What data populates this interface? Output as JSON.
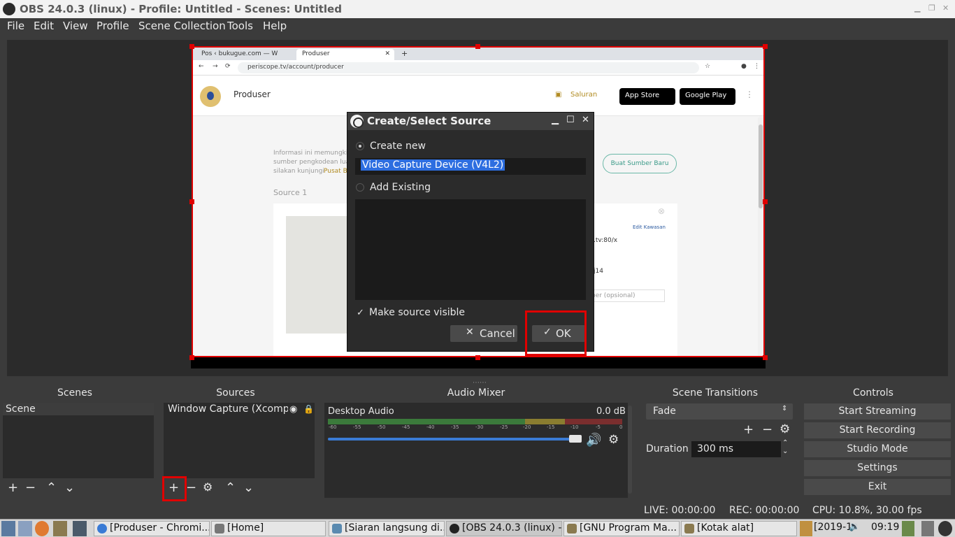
{
  "window": {
    "title": "OBS 24.0.3 (linux) - Profile: Untitled - Scenes: Untitled"
  },
  "menu": [
    "File",
    "Edit",
    "View",
    "Profile",
    "Scene Collection",
    "Tools",
    "Help"
  ],
  "browser": {
    "tab1": "Pos ‹ bukugue.com — W",
    "tab2": "Produser",
    "url": "periscope.tv/account/producer",
    "page_title": "Produser",
    "saluran": "Saluran",
    "appstore": "App Store",
    "googleplay": "Google Play",
    "info1": "Informasi ini memungki",
    "info2": "sumber pengkodean lua",
    "info3": "silakan kunjungi",
    "info3b": "Pusat B",
    "buat_btn": "Buat Sumber Baru",
    "source1": "Source 1",
    "edit": "Edit Kawasan",
    "url_frag": ".tv:80/x",
    "key_frag": "j14",
    "opt_frag": "ber (opsional)"
  },
  "dialog": {
    "title": "Create/Select Source",
    "create_new": "Create new",
    "name_value": "Video Capture Device (V4L2)",
    "add_existing": "Add Existing",
    "make_visible": "Make source visible",
    "cancel": "Cancel",
    "ok": "OK"
  },
  "scenes": {
    "title": "Scenes",
    "items": [
      "Scene"
    ]
  },
  "sources": {
    "title": "Sources",
    "items": [
      "Window Capture (Xcompo"
    ]
  },
  "mixer": {
    "title": "Audio Mixer",
    "channel": "Desktop Audio",
    "db": "0.0 dB",
    "ticks": [
      "-60",
      "-55",
      "-50",
      "-45",
      "-40",
      "-35",
      "-30",
      "-25",
      "-20",
      "-15",
      "-10",
      "-5",
      "0"
    ]
  },
  "transitions": {
    "title": "Scene Transitions",
    "selected": "Fade",
    "duration_label": "Duration",
    "duration_value": "300 ms"
  },
  "controls": {
    "title": "Controls",
    "buttons": [
      "Start Streaming",
      "Start Recording",
      "Studio Mode",
      "Settings",
      "Exit"
    ]
  },
  "status": {
    "live": "LIVE: 00:00:00",
    "rec": "REC: 00:00:00",
    "cpu": "CPU: 10.8%, 30.00 fps"
  },
  "taskbar": {
    "tasks": [
      "[Produser - Chromi...",
      "[Home]",
      "[Siaran langsung di...",
      "[OBS 24.0.3 (linux) -...",
      "[GNU Program Ma...",
      "[Kotak alat]"
    ],
    "clock_date": "[2019-1",
    "clock_time": "09:19"
  }
}
